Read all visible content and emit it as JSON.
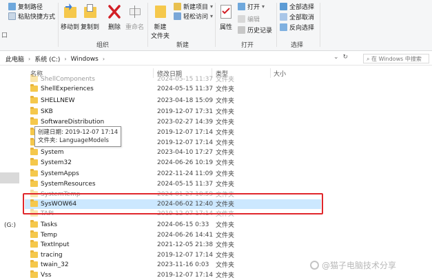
{
  "ribbon": {
    "clipboard": {
      "copy_path": "复制路径",
      "paste_shortcut": "粘贴快捷方式"
    },
    "organize": {
      "label": "组织",
      "move_to": "移动到",
      "copy_to": "复制到",
      "delete": "删除",
      "rename": "重命名"
    },
    "new": {
      "label": "新建",
      "new_folder_line1": "新建",
      "new_folder_line2": "文件夹",
      "new_item": "新建项目",
      "easy_access": "轻松访问"
    },
    "open": {
      "label": "打开",
      "properties": "属性",
      "open": "打开",
      "edit": "编辑",
      "history": "历史记录"
    },
    "select": {
      "label": "选择",
      "select_all": "全部选择",
      "select_none": "全部取消",
      "invert": "反向选择"
    }
  },
  "address": {
    "crumbs": [
      "此电脑",
      "系统 (C:)",
      "Windows"
    ],
    "search_placeholder": "在 Windows 中搜索"
  },
  "nav": {
    "frag_top": "口",
    "frag_drive": "(G:)"
  },
  "columns": {
    "name": "名称",
    "modified": "修改日期",
    "type": "类型",
    "size": "大小"
  },
  "files": [
    {
      "name": "ShellComponents",
      "date": "2024-05-15 11:37",
      "type": "文件夹"
    },
    {
      "name": "ShellExperiences",
      "date": "2024-05-15 11:37",
      "type": "文件夹"
    },
    {
      "name": "SHELLNEW",
      "date": "2023-04-18 15:09",
      "type": "文件夹"
    },
    {
      "name": "SKB",
      "date": "2019-12-07 17:31",
      "type": "文件夹"
    },
    {
      "name": "SoftwareDistribution",
      "date": "2023-02-27 14:39",
      "type": "文件夹"
    },
    {
      "name": "",
      "date": "2019-12-07 17:14",
      "type": "文件夹"
    },
    {
      "name": "",
      "date": "2019-12-07 17:14",
      "type": "文件夹"
    },
    {
      "name": "System",
      "date": "2023-04-10 17:27",
      "type": "文件夹"
    },
    {
      "name": "System32",
      "date": "2024-06-26 10:19",
      "type": "文件夹"
    },
    {
      "name": "SystemApps",
      "date": "2022-11-24 11:09",
      "type": "文件夹"
    },
    {
      "name": "SystemResources",
      "date": "2024-05-15 11:37",
      "type": "文件夹"
    },
    {
      "name": "SystemTemp",
      "date": "2024-01-27 10:59",
      "type": "文件夹"
    },
    {
      "name": "SysWOW64",
      "date": "2024-06-02 12:40",
      "type": "文件夹"
    },
    {
      "name": "TAPI",
      "date": "2019-12-07 17:14",
      "type": "文件夹"
    },
    {
      "name": "Tasks",
      "date": "2024-06-15 0:33",
      "type": "文件夹"
    },
    {
      "name": "Temp",
      "date": "2024-06-26 14:41",
      "type": "文件夹"
    },
    {
      "name": "TextInput",
      "date": "2021-12-05 21:38",
      "type": "文件夹"
    },
    {
      "name": "tracing",
      "date": "2019-12-07 17:14",
      "type": "文件夹"
    },
    {
      "name": "twain_32",
      "date": "2023-11-16 0:03",
      "type": "文件夹"
    },
    {
      "name": "Vss",
      "date": "2019-12-07 17:14",
      "type": "文件夹"
    }
  ],
  "tooltip": {
    "created": "创建日期: 2019-12-07 17:14",
    "folder": "文件夹: LanguageModels"
  },
  "watermark": "@猫子电脑技术分享",
  "colors": {
    "selection": "#cce8ff",
    "highlight_box": "#e0262b",
    "folder": "#f5c84c"
  }
}
